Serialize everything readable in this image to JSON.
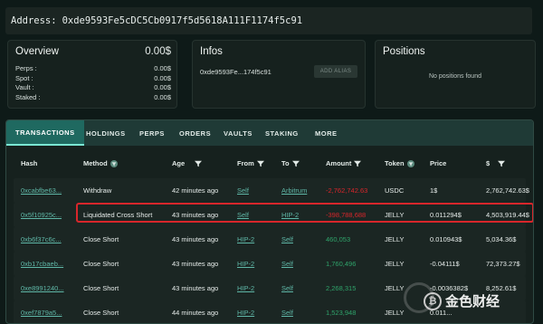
{
  "address_bar": {
    "label": "Address:",
    "value": "0xde9593Fe5cDC5Cb0917f5d5618A111F1174f5c91"
  },
  "overview": {
    "title": "Overview",
    "total": "0.00$",
    "rows": [
      {
        "label": "Perps :",
        "value": "0.00$"
      },
      {
        "label": "Spot :",
        "value": "0.00$"
      },
      {
        "label": "Vault :",
        "value": "0.00$"
      },
      {
        "label": "Staked :",
        "value": "0.00$"
      }
    ]
  },
  "infos": {
    "title": "Infos",
    "address": "0xde9593Fe...174f5c91",
    "add_alias": "ADD ALIAS"
  },
  "positions": {
    "title": "Positions",
    "empty": "No positions found"
  },
  "tabs": [
    "TRANSACTIONS",
    "HOLDINGS",
    "PERPS",
    "ORDERS",
    "VAULTS",
    "STAKING",
    "MORE"
  ],
  "active_tab": "TRANSACTIONS",
  "columns": [
    "Hash",
    "Method",
    "Age",
    "From",
    "To",
    "Amount",
    "Token",
    "Price",
    "$"
  ],
  "rows": [
    {
      "hash": "0xcabfbe63...",
      "method": "Withdraw",
      "age": "42 minutes ago",
      "from": "Self",
      "to": "Arbitrum",
      "amount": "-2,762,742.63",
      "amount_sign": "neg",
      "token": "USDC",
      "price": "1$",
      "usd": "2,762,742.63$",
      "highlight": false
    },
    {
      "hash": "0x5f10925c...",
      "method": "Liquidated Cross Short",
      "age": "43 minutes ago",
      "from": "Self",
      "to": "HIP-2",
      "amount": "-398,788,688",
      "amount_sign": "neg",
      "token": "JELLY",
      "price": "0.011294$",
      "usd": "4,503,919.44$",
      "highlight": true
    },
    {
      "hash": "0xb6f37c6c...",
      "method": "Close Short",
      "age": "43 minutes ago",
      "from": "HIP-2",
      "to": "Self",
      "amount": "460,053",
      "amount_sign": "pos",
      "token": "JELLY",
      "price": "0.010943$",
      "usd": "5,034.36$",
      "highlight": false
    },
    {
      "hash": "0xb17cbaeb...",
      "method": "Close Short",
      "age": "43 minutes ago",
      "from": "HIP-2",
      "to": "Self",
      "amount": "1,760,496",
      "amount_sign": "pos",
      "token": "JELLY",
      "price": "-0.04111$",
      "usd": "72,373.27$",
      "highlight": false
    },
    {
      "hash": "0xe8991240...",
      "method": "Close Short",
      "age": "43 minutes ago",
      "from": "HIP-2",
      "to": "Self",
      "amount": "2,268,315",
      "amount_sign": "pos",
      "token": "JELLY",
      "price": "-0.0036382$",
      "usd": "8,252.61$",
      "highlight": false
    },
    {
      "hash": "0xef7879a5...",
      "method": "Close Short",
      "age": "44 minutes ago",
      "from": "HIP-2",
      "to": "Self",
      "amount": "1,523,948",
      "amount_sign": "pos",
      "token": "JELLY",
      "price": "0.011...",
      "usd": "",
      "highlight": false
    }
  ],
  "watermark": "金色财经",
  "colors": {
    "negative": "#d8262b",
    "positive": "#2fa36a",
    "link": "#5fb7a7",
    "active_tab": "#1f6960"
  }
}
